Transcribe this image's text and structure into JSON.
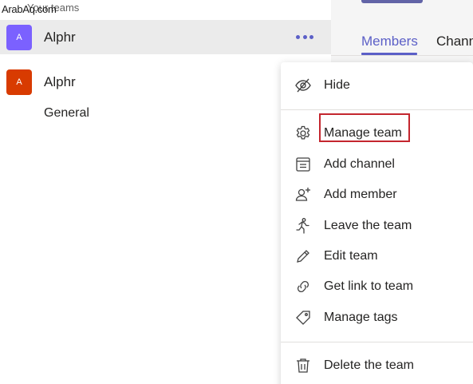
{
  "header": {
    "watermark": "ArabAq.com",
    "title": "Your teams"
  },
  "teams": [
    {
      "initial": "A",
      "name": "Alphr",
      "color": "#7b61ff",
      "selected": true
    },
    {
      "initial": "A",
      "name": "Alphr",
      "color": "#d83b01",
      "selected": false,
      "channels": [
        "General"
      ]
    }
  ],
  "right_pane": {
    "tabs": [
      "Members",
      "Channels"
    ],
    "active_tab": "Members"
  },
  "context_menu": {
    "items": [
      {
        "label": "Hide",
        "icon": "hide-icon"
      },
      {
        "label": "Manage team",
        "icon": "gear-icon",
        "highlighted": true
      },
      {
        "label": "Add channel",
        "icon": "add-channel-icon"
      },
      {
        "label": "Add member",
        "icon": "add-member-icon"
      },
      {
        "label": "Leave the team",
        "icon": "leave-icon"
      },
      {
        "label": "Edit team",
        "icon": "pencil-icon"
      },
      {
        "label": "Get link to team",
        "icon": "link-icon"
      },
      {
        "label": "Manage tags",
        "icon": "tag-icon"
      },
      {
        "label": "Delete the team",
        "icon": "trash-icon"
      }
    ]
  },
  "colors": {
    "accent": "#5b5fc7",
    "highlight_border": "#c4262e"
  }
}
